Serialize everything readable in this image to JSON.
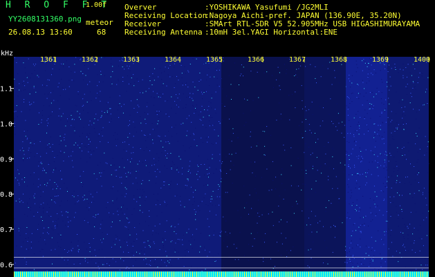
{
  "header": {
    "app_title": "H R O F F T",
    "version": "1.00f",
    "file_name": "YY2608131360.png",
    "date_time": "26.08.13 13:60",
    "mode_label": "meteor",
    "count_value": "68"
  },
  "station_info": [
    {
      "key": "Overver",
      "value": ":YOSHIKAWA Yasufumi /JG2MLI"
    },
    {
      "key": "Receiving Location",
      "value": ":Nagoya Aichi-pref. JAPAN (136.90E, 35.20N)"
    },
    {
      "key": "Receiver",
      "value": ":SMArt RTL-SDR V5 52.905MHz USB HIGASHIMURAYAMA"
    },
    {
      "key": "Receiving Antenna",
      "value": ":10mH 3el.YAGI Horizontal:ENE"
    }
  ],
  "colors": {
    "background": "#000000",
    "header_green": "#33ff66",
    "tick_yellow": "#ffff33",
    "noise_blue": "#1a2fd0",
    "noise_cyan": "#40e0ff",
    "baseline_cyan": "#00e5ff"
  },
  "chart_data": {
    "type": "heatmap",
    "y_unit": "kHz",
    "x_ticks": [
      "1361",
      "1362",
      "1363",
      "1364",
      "1365",
      "1366",
      "1367",
      "1368",
      "1369",
      "1400"
    ],
    "y_ticks": [
      "1.1",
      "1.0",
      "0.9",
      "0.8",
      "0.7",
      "0.6"
    ],
    "y_values": [
      1.1,
      1.0,
      0.9,
      0.8,
      0.7,
      0.6
    ],
    "ylim": [
      0.58,
      1.19
    ],
    "column_intensity": [
      0.55,
      0.55,
      0.55,
      0.55,
      0.55,
      0.2,
      0.2,
      0.3,
      0.75,
      0.5
    ]
  }
}
